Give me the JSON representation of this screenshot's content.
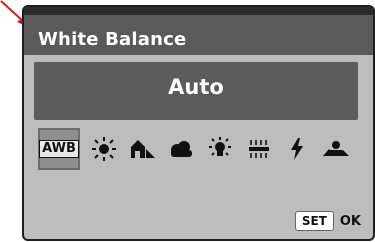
{
  "title": "White Balance",
  "value": "Auto",
  "wb_options": [
    {
      "label": "AWB",
      "icon": "awb-icon"
    },
    {
      "label": "",
      "icon": "daylight-icon"
    },
    {
      "label": "",
      "icon": "shade-icon"
    },
    {
      "label": "",
      "icon": "cloudy-icon"
    },
    {
      "label": "",
      "icon": "tungsten-icon"
    },
    {
      "label": "",
      "icon": "fluorescent-icon"
    },
    {
      "label": "",
      "icon": "flash-icon"
    },
    {
      "label": "",
      "icon": "custom-wb-icon"
    }
  ],
  "footer": {
    "set_label": "SET",
    "ok_label": "OK"
  },
  "colors": {
    "title_bar": "#5a5a5a",
    "panel": "#bdbdbd",
    "value_bar": "#5b5b5b",
    "arrow": "#e11b1b"
  }
}
